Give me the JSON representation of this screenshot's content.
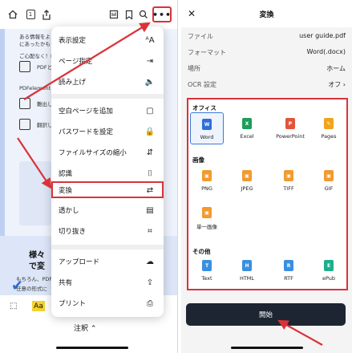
{
  "left": {
    "toolbar": {
      "home_icon": "home-icon",
      "page_icon": "1",
      "share_icon": "share-icon",
      "more_label": "•••"
    },
    "doc": {
      "line1": "ある情報をより早",
      "line2": "にあったかもし",
      "line3": "ご心配なく！PDF",
      "pdf_label": "PDFと",
      "pdfelement_label": "PDFelement AI",
      "item3": "難出し",
      "item4": "翻訳し",
      "big1": "様々",
      "big2": "で変",
      "foot1": "もちろん、PDFe",
      "foot2": "任意の形式に"
    },
    "bottom": {
      "aa_label": "Aa",
      "annotation_label": "注釈 ⌃"
    },
    "menu": {
      "items": [
        {
          "label": "表示設定",
          "icon": "ᴬA"
        },
        {
          "label": "ページ指定",
          "icon": "⇥"
        },
        {
          "label": "読み上げ",
          "icon": "🔈"
        },
        {
          "label": "空白ページを追加",
          "icon": "▢"
        },
        {
          "label": "パスワードを設定",
          "icon": "🔒"
        },
        {
          "label": "ファイルサイズの縮小",
          "icon": "⇵"
        },
        {
          "label": "認識",
          "icon": "⌷"
        },
        {
          "label": "変換",
          "icon": "⇄"
        },
        {
          "label": "透かし",
          "icon": "▤"
        },
        {
          "label": "切り抜き",
          "icon": "⌗"
        },
        {
          "label": "アップロード",
          "icon": "☁"
        },
        {
          "label": "共有",
          "icon": "⇪"
        },
        {
          "label": "プリント",
          "icon": "⎙"
        }
      ]
    }
  },
  "right": {
    "title": "変換",
    "rows": [
      {
        "key": "ファイル",
        "value": "user guide.pdf"
      },
      {
        "key": "フォーマット",
        "value": "Word(.docx)"
      },
      {
        "key": "場所",
        "value": "ホーム"
      },
      {
        "key": "OCR 設定",
        "value": "オフ ›"
      }
    ],
    "sections": [
      {
        "title": "オフィス",
        "formats": [
          {
            "label": "Word",
            "color": "#2f6fd6",
            "selected": true
          },
          {
            "label": "Excel",
            "color": "#1f9d5a"
          },
          {
            "label": "PowerPoint",
            "color": "#e2543b"
          },
          {
            "label": "Pages",
            "color": "#f2a31c"
          }
        ]
      },
      {
        "title": "画像",
        "formats": [
          {
            "label": "PNG",
            "color": "#f29a2e"
          },
          {
            "label": "JPEG",
            "color": "#f29a2e"
          },
          {
            "label": "TIFF",
            "color": "#f29a2e"
          },
          {
            "label": "GIF",
            "color": "#f29a2e"
          },
          {
            "label": "単一画像",
            "color": "#f29a2e"
          }
        ]
      },
      {
        "title": "その他",
        "formats": [
          {
            "label": "Text",
            "color": "#3a8fe0"
          },
          {
            "label": "HTML",
            "color": "#3a8fe0"
          },
          {
            "label": "RTF",
            "color": "#3a8fe0"
          },
          {
            "label": "ePub",
            "color": "#1fae8c"
          }
        ]
      }
    ],
    "start_label": "開始"
  },
  "colors": {
    "accent_red": "#d9333a",
    "selected_blue": "#3a7bd5",
    "start_button": "#1d2532"
  }
}
